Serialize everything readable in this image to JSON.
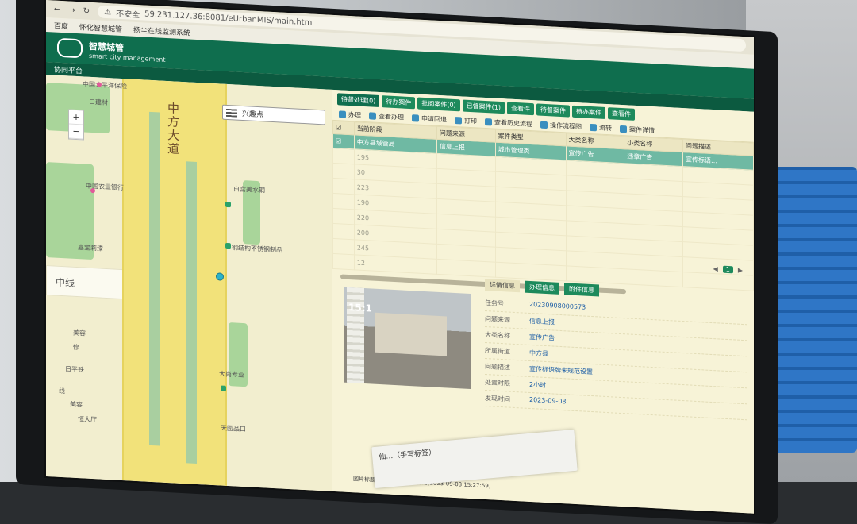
{
  "browser": {
    "security_label": "不安全",
    "url": "59.231.127.36:8081/eUrbanMIS/main.htm",
    "bookmarks": [
      "百度",
      "怀化智慧城管",
      "扬尘在线监测系统"
    ]
  },
  "app": {
    "title": "智慧城管",
    "subtitle": "smart city management",
    "platform": "协同平台"
  },
  "map": {
    "road_main": "中方大道",
    "search_placeholder": "兴趣点",
    "zoom_in": "+",
    "zoom_out": "−",
    "labels": {
      "l1": "中国太平洋保险",
      "l2": "口建材",
      "l3": "中国农业银行",
      "l4": "嘉宝莉漆",
      "l5": "中线",
      "l6": "白宫美水钢",
      "l7": "钢结构不锈钢制品",
      "l8": "美容",
      "l9": "修",
      "l10": "日平铁",
      "l11": "大尚专业",
      "l12": "美容",
      "l13": "恒大厅",
      "l14": "天园品口",
      "l15": "线"
    }
  },
  "tabs": [
    "待督处理(0)",
    "待办案件",
    "批阅案件(0)",
    "已督案件(1)",
    "查看件",
    "待督案件",
    "待办案件",
    "查看件"
  ],
  "toolbar": [
    "办理",
    "查看办理",
    "申请回退",
    "打印",
    "查看历史流程",
    "操作流程图",
    "流转",
    "案件详情"
  ],
  "table": {
    "headers": [
      "当前阶段",
      "问题来源",
      "案件类型",
      "大类名称",
      "小类名称",
      "问题描述"
    ],
    "rows": [
      [
        "中方县城管局",
        "信息上报",
        "城市管理类",
        "宣传广告",
        "违章广告",
        "宣传标语…"
      ]
    ],
    "row_numbers": [
      "195",
      "30",
      "223",
      "190",
      "220",
      "200",
      "245",
      "12"
    ]
  },
  "detail": {
    "tabs": [
      "详情信息",
      "办理信息",
      "附件信息"
    ],
    "photo_time": "15:1",
    "caption": "图片标题[1-2/4]中方县城管局[2023-09-08 15:27:59]",
    "info": [
      {
        "k": "任务号",
        "v": "20230908000573"
      },
      {
        "k": "问题来源",
        "v": "信息上报"
      },
      {
        "k": "大类名称",
        "v": "宣传广告"
      },
      {
        "k": "所属街道",
        "v": "中方县"
      },
      {
        "k": "问题描述",
        "v": "宣传标语牌未规范设置"
      },
      {
        "k": "处置时限",
        "v": "2小时"
      },
      {
        "k": "发现时间",
        "v": "2023-09-08"
      }
    ]
  },
  "paper_note": "仙…（手写标签）"
}
